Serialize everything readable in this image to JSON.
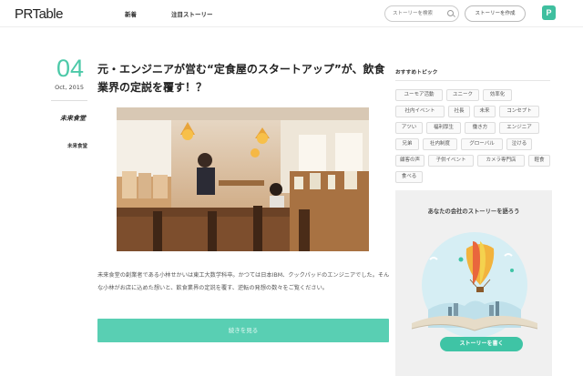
{
  "header": {
    "logo": "PRTable",
    "nav": {
      "new": "新着",
      "featured": "注目ストーリー"
    },
    "search_placeholder": "ストーリーを検索",
    "create_label": "ストーリーを作成",
    "avatar_letter": "P"
  },
  "article": {
    "date_day": "04",
    "date_month": "Oct, 2015",
    "company_logo_text": "未来食堂",
    "company_name": "未来食堂",
    "title": "元・エンジニアが営む“定食屋のスタートアップ”が、飲食業界の定説を覆す！？",
    "body": "未来食堂の創業者である小林せかいは東工大数学科卒。かつては日本IBM、クックパッドのエンジニアでした。そんな小林がお店に込めた想いと、飲食業界の定説を覆す、逆転の発想の数々をご覧ください。",
    "more_label": "続きを見る"
  },
  "sidebar": {
    "recommended_title": "おすすめトピック",
    "tags": [
      "ユーモア活動",
      "ユニーク",
      "効率化",
      "社内イベント",
      "社長",
      "未来",
      "コンセプト",
      "アツい",
      "福利厚生",
      "働き方",
      "エンジニア",
      "兄弟",
      "社内制度",
      "グローバル",
      "泣ける",
      "顧客の声",
      "子供イベント",
      "カメラ専門店",
      "軽食",
      "食べる"
    ],
    "promo_title": "あなたの会社のストーリーを語ろう",
    "promo_button": "ストーリーを書く"
  }
}
